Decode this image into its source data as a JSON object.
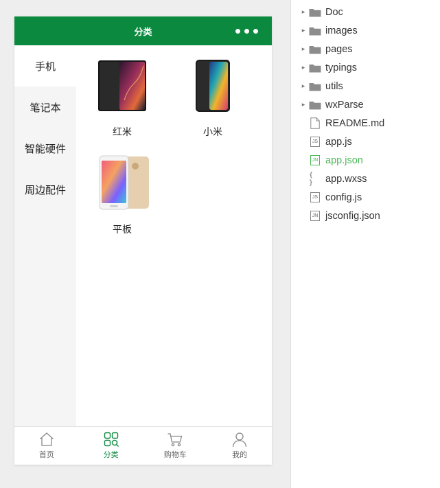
{
  "navbar": {
    "title": "分类"
  },
  "sidebar": {
    "items": [
      {
        "label": "手机",
        "active": true
      },
      {
        "label": "笔记本",
        "active": false
      },
      {
        "label": "智能硬件",
        "active": false
      },
      {
        "label": "周边配件",
        "active": false
      }
    ]
  },
  "products": [
    {
      "name": "红米"
    },
    {
      "name": "小米"
    },
    {
      "name": "平板"
    }
  ],
  "tabbar": [
    {
      "label": "首页",
      "icon": "home-icon",
      "active": false
    },
    {
      "label": "分类",
      "icon": "category-icon",
      "active": true
    },
    {
      "label": "购物车",
      "icon": "cart-icon",
      "active": false
    },
    {
      "label": "我的",
      "icon": "user-icon",
      "active": false
    }
  ],
  "file_tree": [
    {
      "name": "Doc",
      "type": "folder"
    },
    {
      "name": "images",
      "type": "folder"
    },
    {
      "name": "pages",
      "type": "folder"
    },
    {
      "name": "typings",
      "type": "folder"
    },
    {
      "name": "utils",
      "type": "folder"
    },
    {
      "name": "wxParse",
      "type": "folder"
    },
    {
      "name": "README.md",
      "type": "file-md"
    },
    {
      "name": "app.js",
      "type": "file-js",
      "badge": "JS"
    },
    {
      "name": "app.json",
      "type": "file-json",
      "badge": "JN",
      "highlighted": true
    },
    {
      "name": "app.wxss",
      "type": "file-wxss"
    },
    {
      "name": "config.js",
      "type": "file-js",
      "badge": "JS"
    },
    {
      "name": "jsconfig.json",
      "type": "file-json",
      "badge": "JN"
    }
  ],
  "colors": {
    "brand_green": "#0b8a3f",
    "highlight_green": "#4cb859",
    "sidebar_bg": "#f5f5f5",
    "simulator_bg": "#eeeeee"
  }
}
